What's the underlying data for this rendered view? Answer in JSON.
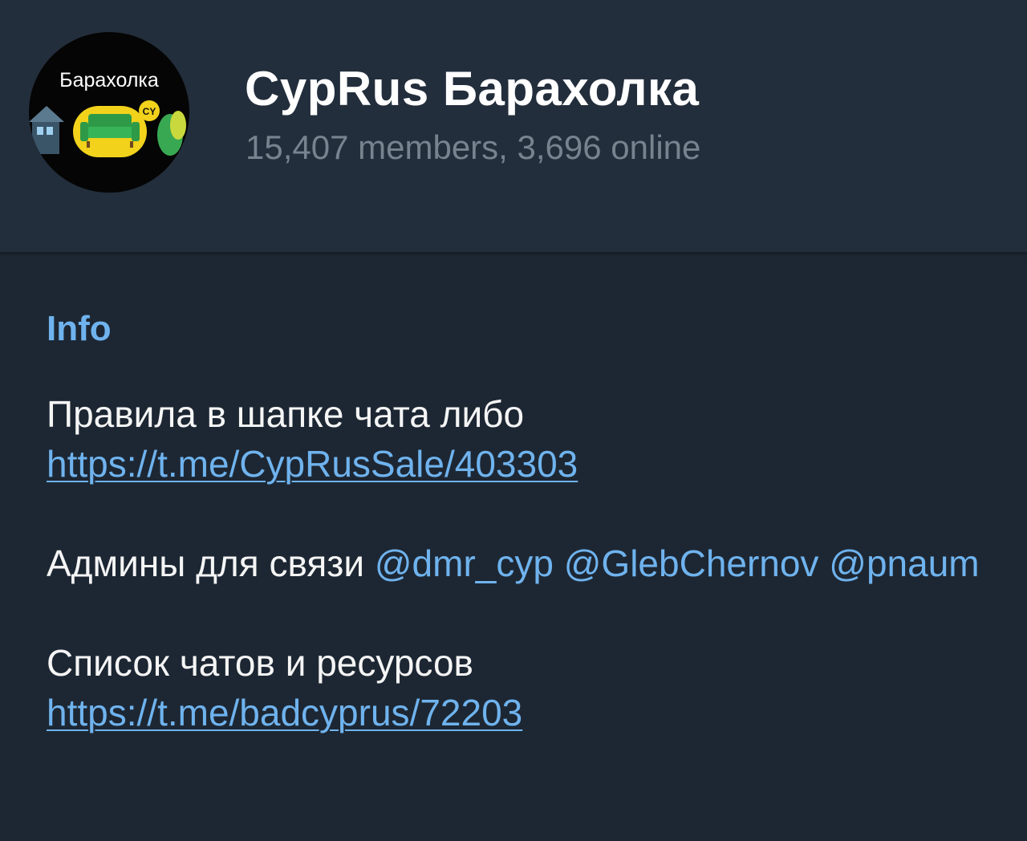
{
  "chat": {
    "title": "CypRus Барахолка",
    "status": "15,407 members, 3,696 online",
    "avatar": {
      "logo_text": "Барахолка",
      "badge_text": "CY",
      "icon": "sofa-icon"
    }
  },
  "info": {
    "label": "Info",
    "rules_text": "Правила в шапке чата либо",
    "rules_link": "https://t.me/CypRusSale/403303",
    "admins_text": "Админы для связи",
    "admins": [
      "@dmr_cyp",
      "@GlebChernov",
      "@pnaum"
    ],
    "resources_text": "Список чатов и ресурсов",
    "resources_link": "https://t.me/badcyprus/72203"
  },
  "colors": {
    "background": "#1d2733",
    "header": "#232e3c",
    "accent": "#6fb3ee",
    "muted": "#78838f",
    "text": "#f5f5f5"
  }
}
